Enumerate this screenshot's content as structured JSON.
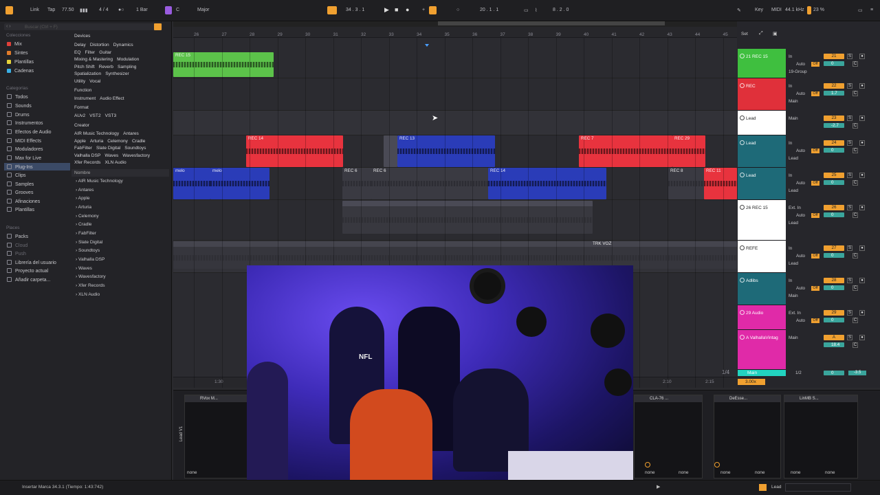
{
  "topbar": {
    "link": "Link",
    "tap": "Tap",
    "tempo": "77.50",
    "meter": "4 / 4",
    "quantize": "1 Bar",
    "key": "C",
    "scale": "Major",
    "position": "34 .  3 .  1",
    "loop_start": "20 .  1 .  1",
    "loop_length": "8 .  2 .  0",
    "key_label": "Key",
    "midi_label": "MIDI",
    "sample_rate": "44.1 kHz",
    "cpu": "23 %"
  },
  "browser": {
    "search_placeholder": "Buscar (Ctrl + F)",
    "collections_title": "Colecciones",
    "collections": [
      {
        "label": "Mix",
        "color": "#e0403a"
      },
      {
        "label": "Sintes",
        "color": "#e07b2a"
      },
      {
        "label": "Plantillas",
        "color": "#e6d33a"
      },
      {
        "label": "Cadenas",
        "color": "#3ab0e6"
      }
    ],
    "categories_title": "Categorías",
    "categories": [
      "Todos",
      "Sounds",
      "Drums",
      "Instrumentos",
      "Efectos de Audio",
      "MIDI Effects",
      "Moduladores",
      "Max for Live",
      "Plug-Ins",
      "Clips",
      "Samples",
      "Grooves",
      "Afinaciones",
      "Plantillas"
    ],
    "places_title": "Places",
    "places": [
      "Packs",
      "Cloud",
      "Push",
      "Librería del usuario",
      "Proyecto actual",
      "Añadir carpeta..."
    ],
    "devices_title": "Devices",
    "device_rows": [
      [
        "Delay",
        "Distortion",
        "Dynamics"
      ],
      [
        "EQ",
        "Filter",
        "Guitar"
      ],
      [
        "Mixing & Mastering",
        "Modulation"
      ],
      [
        "Pitch Shift",
        "Reverb",
        "Sampling"
      ],
      [
        "Spatialization",
        "Synthesizer"
      ],
      [
        "Utility",
        "Vocal"
      ]
    ],
    "function_title": "Function",
    "function_row": [
      "Instrument",
      "Audio Effect"
    ],
    "format_title": "Format",
    "format_row": [
      "AUv2",
      "VST2",
      "VST3"
    ],
    "creator_title": "Creator",
    "creator_rows": [
      [
        "AIR Music Technology",
        "Antares"
      ],
      [
        "Apple",
        "Arturia",
        "Celemony",
        "Cradle"
      ],
      [
        "FabFilter",
        "Slate Digital",
        "Soundtoys"
      ],
      [
        "Valhalla DSP",
        "Waves",
        "Wavesfactory"
      ],
      [
        "Xfer Records",
        "XLN Audio"
      ]
    ],
    "name_header": "Nombre",
    "tree": [
      "AIR Music Technology",
      "Antares",
      "Apple",
      "Arturia",
      "Celemony",
      "Cradle",
      "FabFilter",
      "Slate Digital",
      "Soundtoys",
      "Valhalla DSP",
      "Waves",
      "Wavesfactory",
      "Xfer Records",
      "XLN Audio"
    ]
  },
  "ruler": [
    "26",
    "27",
    "28",
    "29",
    "30",
    "31",
    "32",
    "33",
    "34",
    "35",
    "36",
    "37",
    "38",
    "39",
    "40",
    "41",
    "42",
    "43",
    "44",
    "45"
  ],
  "clips": {
    "green": "REC 15",
    "red1": "REC 14",
    "blue1": "REC 13",
    "red2": "REC 7",
    "red3": "REC 29",
    "melo1": "melo",
    "melo2": "melo",
    "blue2": "REC 14",
    "gray1": "REC 6",
    "gray2": "REC 6",
    "gray3": "REC 8",
    "red4": "REC 11",
    "gray4": "REC 9",
    "voz1": "TRK VOZ",
    "voz2": "TRK VOZ"
  },
  "arr_footer": {
    "t1": "1:30",
    "t2": "2:10",
    "t3": "2:15",
    "page": "1/4",
    "zoom": "3.00x"
  },
  "mixer": {
    "header": "Set",
    "tracks": [
      {
        "name": "21 REC 15",
        "color": "#3fbf3f",
        "io": "In",
        "auto": "Auto",
        "route": "19-Group",
        "num": "21",
        "vol": "0"
      },
      {
        "name": "REC",
        "color": "#e0303a",
        "io": "In",
        "auto": "Auto",
        "route": "Main",
        "num": "22",
        "vol": "1.7"
      },
      {
        "name": "Lead",
        "color": "#ffffff",
        "io": "Main",
        "auto": "",
        "route": "",
        "num": "23",
        "vol": "-2.7"
      },
      {
        "name": "Lead",
        "color": "#1e6a78",
        "io": "In",
        "auto": "Auto",
        "route": "Lead",
        "num": "24",
        "vol": "0"
      },
      {
        "name": "Lead",
        "color": "#1e6a78",
        "io": "In",
        "auto": "Auto",
        "route": "Lead",
        "num": "25",
        "vol": "0"
      },
      {
        "name": "26 REC 15",
        "color": "#ffffff",
        "io": "Ext. In",
        "auto": "Auto",
        "route": "Lead",
        "num": "26",
        "vol": "0"
      },
      {
        "name": "REFE",
        "color": "#ffffff",
        "io": "In",
        "auto": "Auto",
        "route": "Lead",
        "num": "27",
        "vol": "0"
      },
      {
        "name": "Adlibs",
        "color": "#1e6a78",
        "io": "In",
        "auto": "Auto",
        "route": "Main",
        "num": "28",
        "vol": "0"
      },
      {
        "name": "29 Audio",
        "color": "#e02aa8",
        "io": "Ext. In",
        "auto": "Auto",
        "route": "",
        "num": "29",
        "vol": "0"
      },
      {
        "name": "A ValhallaVintag",
        "color": "#e02aa8",
        "io": "Main",
        "auto": "",
        "route": "",
        "num": "A",
        "vol": "18.4"
      }
    ],
    "main": {
      "name": "Main",
      "ratio": "1/2",
      "vol": "0",
      "db": "-3.5"
    }
  },
  "devices": {
    "panels": [
      "RVox M...",
      "CLA-76 ...",
      "DeEsse...",
      "LinMB S..."
    ],
    "none_label": "none",
    "track_label": "Lead V1"
  },
  "webcam": {
    "caption": "NFL"
  },
  "status": {
    "message": "Insertar Marca 34.3.1 (Tiempo: 1:43:742)",
    "track": "Lead"
  }
}
